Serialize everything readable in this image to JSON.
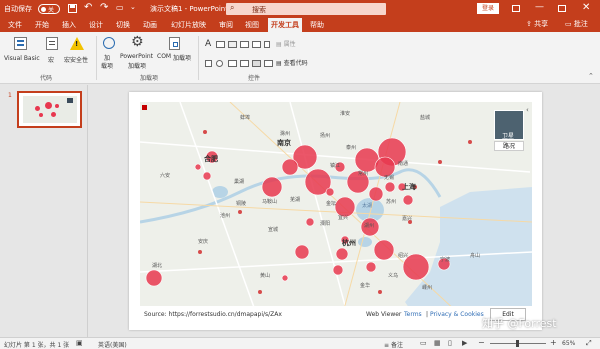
{
  "titlebar": {
    "autosave_label": "自动保存",
    "autosave_state": "关",
    "doc_title": "演示文稿1 - PowerPoint",
    "search_placeholder": "搜索",
    "login_label": "登录",
    "colors": {
      "brand": "#c43e1c"
    }
  },
  "tabs": [
    "文件",
    "开始",
    "插入",
    "设计",
    "切换",
    "动画",
    "幻灯片放映",
    "审阅",
    "视图",
    "开发工具",
    "帮助"
  ],
  "active_tab": "开发工具",
  "share_label": "共享",
  "comment_label": "批注",
  "ribbon": {
    "code_group": {
      "label": "代码",
      "buttons": [
        "Visual Basic",
        "宏",
        "宏安全性"
      ]
    },
    "addins_group": {
      "label": "加载项",
      "buttons": [
        {
          "line1": "加",
          "line2": "载项"
        },
        {
          "line1": "PowerPoint",
          "line2": "加载项"
        },
        {
          "line1": "COM",
          "line2": "加载项"
        }
      ]
    },
    "controls_group": {
      "label": "控件",
      "properties_label": "属性",
      "view_code_label": "查看代码"
    }
  },
  "slide_panel": {
    "slide_number": "1"
  },
  "map": {
    "source_text": "Source: https://forrestsudio.cn/dmapapi/s/ZAx",
    "viewer_label": "Web Viewer",
    "terms_label": "Terms",
    "privacy_label": "Privacy & Cookies",
    "edit_label": "Edit",
    "satellite_label": "卫星",
    "roads_label": "路况",
    "city_labels": [
      "合肥",
      "南京",
      "上海",
      "杭州",
      "太湖",
      "无锡",
      "常州",
      "镇江",
      "苏州",
      "湖州",
      "嘉兴",
      "宁波",
      "绍兴",
      "芜湖",
      "宣城",
      "马鞍山",
      "滁州",
      "扬州",
      "泰州",
      "南通",
      "安庆",
      "池州",
      "铜陵",
      "黄山",
      "金华",
      "舟山",
      "盐城",
      "淮安",
      "蚌埠",
      "六安",
      "巢湖",
      "宜兴",
      "溧阳",
      "湖北",
      "金坛",
      "嵊州",
      "义乌"
    ],
    "bubble_color": "#e8384f"
  },
  "watermark": "知乎 @Forrest",
  "status": {
    "slide_info": "幻灯片 第 1 张，共 1 张",
    "language": "英语(美国)",
    "notes_label": "备注",
    "zoom": "65%"
  }
}
